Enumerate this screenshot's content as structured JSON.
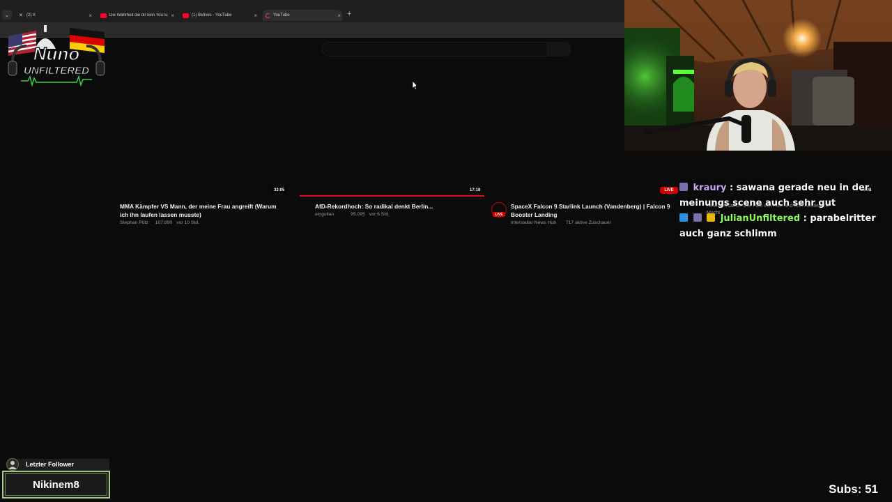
{
  "browser": {
    "tabs": [
      {
        "title": "(2) X",
        "favicon": "x-icon"
      },
      {
        "title": "Die Wahrheit die dir kein YouTu",
        "favicon": "youtube-icon"
      },
      {
        "title": "(1) BeIlves - YouTube",
        "favicon": "youtube-icon"
      },
      {
        "title": "YouTube",
        "favicon": "loading-icon",
        "active": true
      }
    ],
    "close_glyph": "×",
    "new_tab_glyph": "+",
    "tab_menu_glyph": "⌄"
  },
  "youtube": {
    "videos": [
      {
        "duration": "32:05",
        "title_line1": "MMA Kämpfer VS Mann, der meine Frau angreift (Warum",
        "title_line2": "ich ihn laufen lassen musste)",
        "channel": "Stephan Pütz",
        "views": "107.890",
        "age": "vor 10 Std."
      },
      {
        "duration": "17:18",
        "watched_fraction": 1.0,
        "title_line1": "AfD-Rekordhoch: So radikal denkt Berlin...",
        "channel": "eingollan",
        "views": "95.095",
        "age": "vor 6 Std."
      },
      {
        "live_label": "LIVE",
        "title_line1": "SpaceX Falcon 9 Starlink Launch (Vandenberg) | Falcon 9",
        "title_line2": "Booster Landing",
        "channel": "Interstellar News Hub",
        "viewers": "717 aktive Zuschauer"
      },
      {
        "duration": "29:08",
        "title_line1": "Nescht Ardasch: Der Pate von Köln und sein Aufstieg zur",
        "title_line2": "Macht"
      }
    ],
    "live_badge": "LIVE"
  },
  "overlay": {
    "logo": {
      "line1": "Nuno",
      "line2": "UNFILTERED"
    },
    "chat": [
      {
        "user": "kraury",
        "message": ": sawana gerade neu in der meinungs scene auch sehr gut"
      },
      {
        "user": "JulianUnfiltered",
        "message": ": parabelritter auch ganz schlimm"
      }
    ],
    "follower": {
      "header": "Letzter Follower",
      "name": "Nikinem8"
    },
    "subs": "Subs: 51"
  },
  "colors": {
    "accent_red": "#cc0000",
    "progress_red": "#e50914",
    "chat_user1": "#c9a6f0",
    "chat_user2": "#8aff5c"
  }
}
